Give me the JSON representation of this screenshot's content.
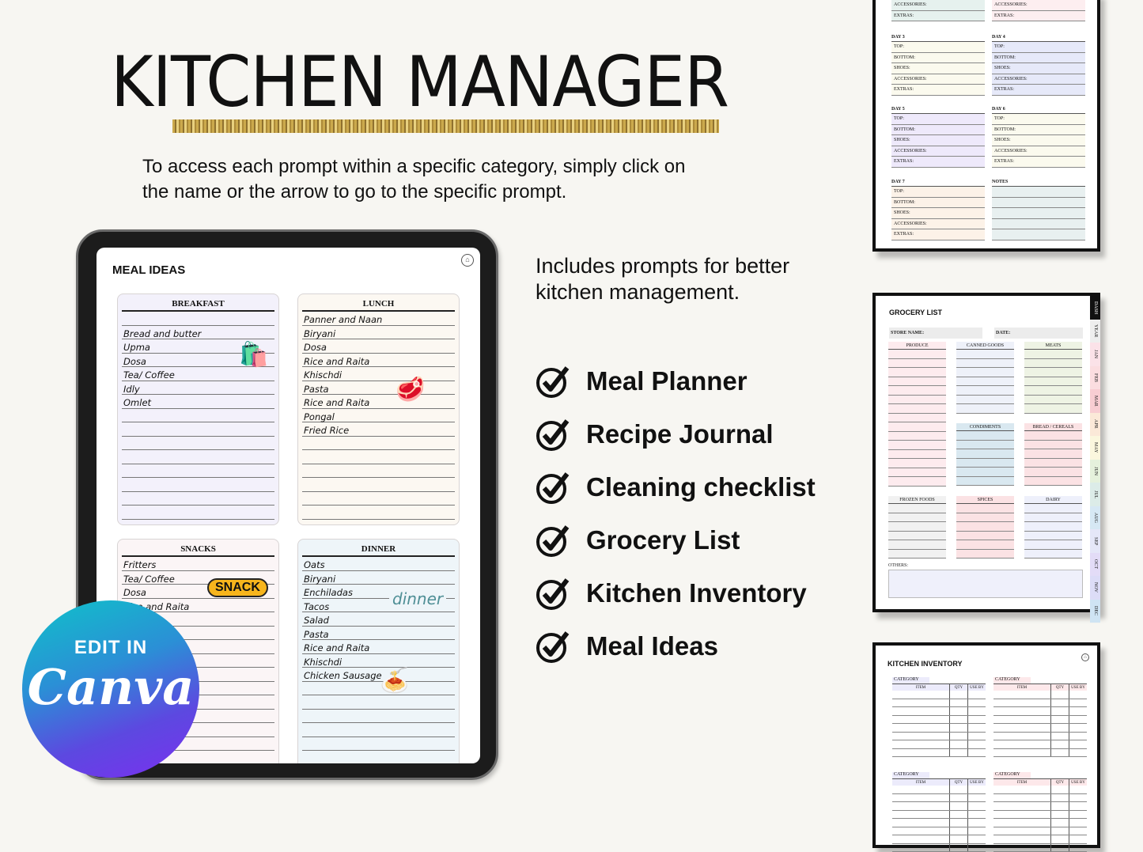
{
  "hero": {
    "title": "KITCHEN MANAGER",
    "subtitle_line1": "To access each prompt within a specific category, simply click on",
    "subtitle_line2": "the name or the arrow to go to the specific prompt."
  },
  "tablet": {
    "screen_title": "MEAL IDEAS",
    "home_icon": "⌂",
    "cards": [
      {
        "title": "BREAKFAST",
        "bg": "#f3f1fb",
        "items": [
          "",
          "Bread and butter",
          "Upma",
          "Dosa",
          "Tea/ Coffee",
          "Idly",
          "Omlet",
          "",
          "",
          "",
          "",
          "",
          "",
          "",
          ""
        ]
      },
      {
        "title": "LUNCH",
        "bg": "#fcf8f2",
        "items": [
          "Panner and Naan",
          "Biryani",
          "Dosa",
          "Rice and Raita",
          "Khischdi",
          "Pasta",
          "Rice and Raita",
          "Pongal",
          "Fried Rice",
          "",
          "",
          "",
          "",
          "",
          ""
        ]
      },
      {
        "title": "SNACKS",
        "bg": "#fbf5f6",
        "items": [
          "Fritters",
          "Tea/ Coffee",
          "Dosa",
          "Rice and Raita",
          "",
          "",
          "",
          "",
          "",
          "",
          "",
          "",
          "",
          "",
          ""
        ]
      },
      {
        "title": "DINNER",
        "bg": "#eef5f9",
        "items": [
          "Oats",
          "Biryani",
          "Enchiladas",
          "Tacos",
          "Salad",
          "Pasta",
          "Rice and Raita",
          "Khischdi",
          "Chicken Sausage",
          "",
          "",
          "",
          "",
          "",
          ""
        ]
      }
    ],
    "snack_badge": "SNACK",
    "dinner_word": "dinner"
  },
  "canva_badge": {
    "line1": "EDIT IN",
    "line2": "Canva"
  },
  "includes": {
    "line1": "Includes prompts for better",
    "line2": "kitchen management."
  },
  "features": [
    "Meal Planner",
    "Recipe Journal",
    "Cleaning checklist",
    "Grocery List",
    "Kitchen Inventory",
    "Meal Ideas"
  ],
  "outfit_preview": {
    "top_rows": [
      "ACCESSORIES:",
      "EXTRAS:"
    ],
    "days": [
      {
        "label": "DAY 3",
        "bg": "#fbfaee"
      },
      {
        "label": "DAY 4",
        "bg": "#e6e9f9"
      },
      {
        "label": "DAY 5",
        "bg": "#eee9fb"
      },
      {
        "label": "DAY 6",
        "bg": "#fbfaee"
      },
      {
        "label": "DAY 7",
        "bg": "#fcf2e8"
      }
    ],
    "rows": [
      "TOP:",
      "BOTTOM:",
      "SHOES:",
      "ACCESSORIES:",
      "EXTRAS:"
    ],
    "notes_label": "NOTES"
  },
  "grocery_preview": {
    "title": "GROCERY LIST",
    "store_label": "STORE NAME:",
    "date_label": "DATE:",
    "sections": [
      {
        "label": "PRODUCE",
        "bg": "#fdebee"
      },
      {
        "label": "CANNED GOODS",
        "bg": "#eef1f9"
      },
      {
        "label": "MEATS",
        "bg": "#eef3e4"
      },
      {
        "label": "CONDIMENTS",
        "bg": "#d9e8f0"
      },
      {
        "label": "BREAD / CEREALS",
        "bg": "#fbe2e4"
      },
      {
        "label": "FROZEN FOODS",
        "bg": "#f1f1f1"
      },
      {
        "label": "SPICES",
        "bg": "#fbe2e4"
      },
      {
        "label": "DAIRY",
        "bg": "#eef0fb"
      }
    ],
    "others_label": "OTHERS:",
    "tabs": [
      {
        "label": "DASH",
        "bg": "#111111",
        "fg": "#ffffff"
      },
      {
        "label": "YEAR",
        "bg": "#eeeeee",
        "fg": "#222222"
      },
      {
        "label": "JAN",
        "bg": "#fbe2e8",
        "fg": "#222222"
      },
      {
        "label": "FEB",
        "bg": "#fbdde0",
        "fg": "#222222"
      },
      {
        "label": "MAR",
        "bg": "#f8cdd2",
        "fg": "#222222"
      },
      {
        "label": "APR",
        "bg": "#fbe9d8",
        "fg": "#222222"
      },
      {
        "label": "MAY",
        "bg": "#fbf7de",
        "fg": "#222222"
      },
      {
        "label": "JUN",
        "bg": "#e5f1dc",
        "fg": "#222222"
      },
      {
        "label": "JUL",
        "bg": "#dcece8",
        "fg": "#222222"
      },
      {
        "label": "AUG",
        "bg": "#d6e8f4",
        "fg": "#222222"
      },
      {
        "label": "SEP",
        "bg": "#e5e7f8",
        "fg": "#222222"
      },
      {
        "label": "OCT",
        "bg": "#e3dcf7",
        "fg": "#222222"
      },
      {
        "label": "NOV",
        "bg": "#dcdcf7",
        "fg": "#222222"
      },
      {
        "label": "DEC",
        "bg": "#cfe4f3",
        "fg": "#222222"
      }
    ]
  },
  "inventory_preview": {
    "title": "KITCHEN INVENTORY",
    "category_label": "CATEGORY",
    "headers": [
      "ITEM",
      "QTY",
      "USE BY"
    ],
    "block_colors": [
      "#ecebfb",
      "#fde8ea",
      "#ecebfb",
      "#fde8ea"
    ]
  }
}
